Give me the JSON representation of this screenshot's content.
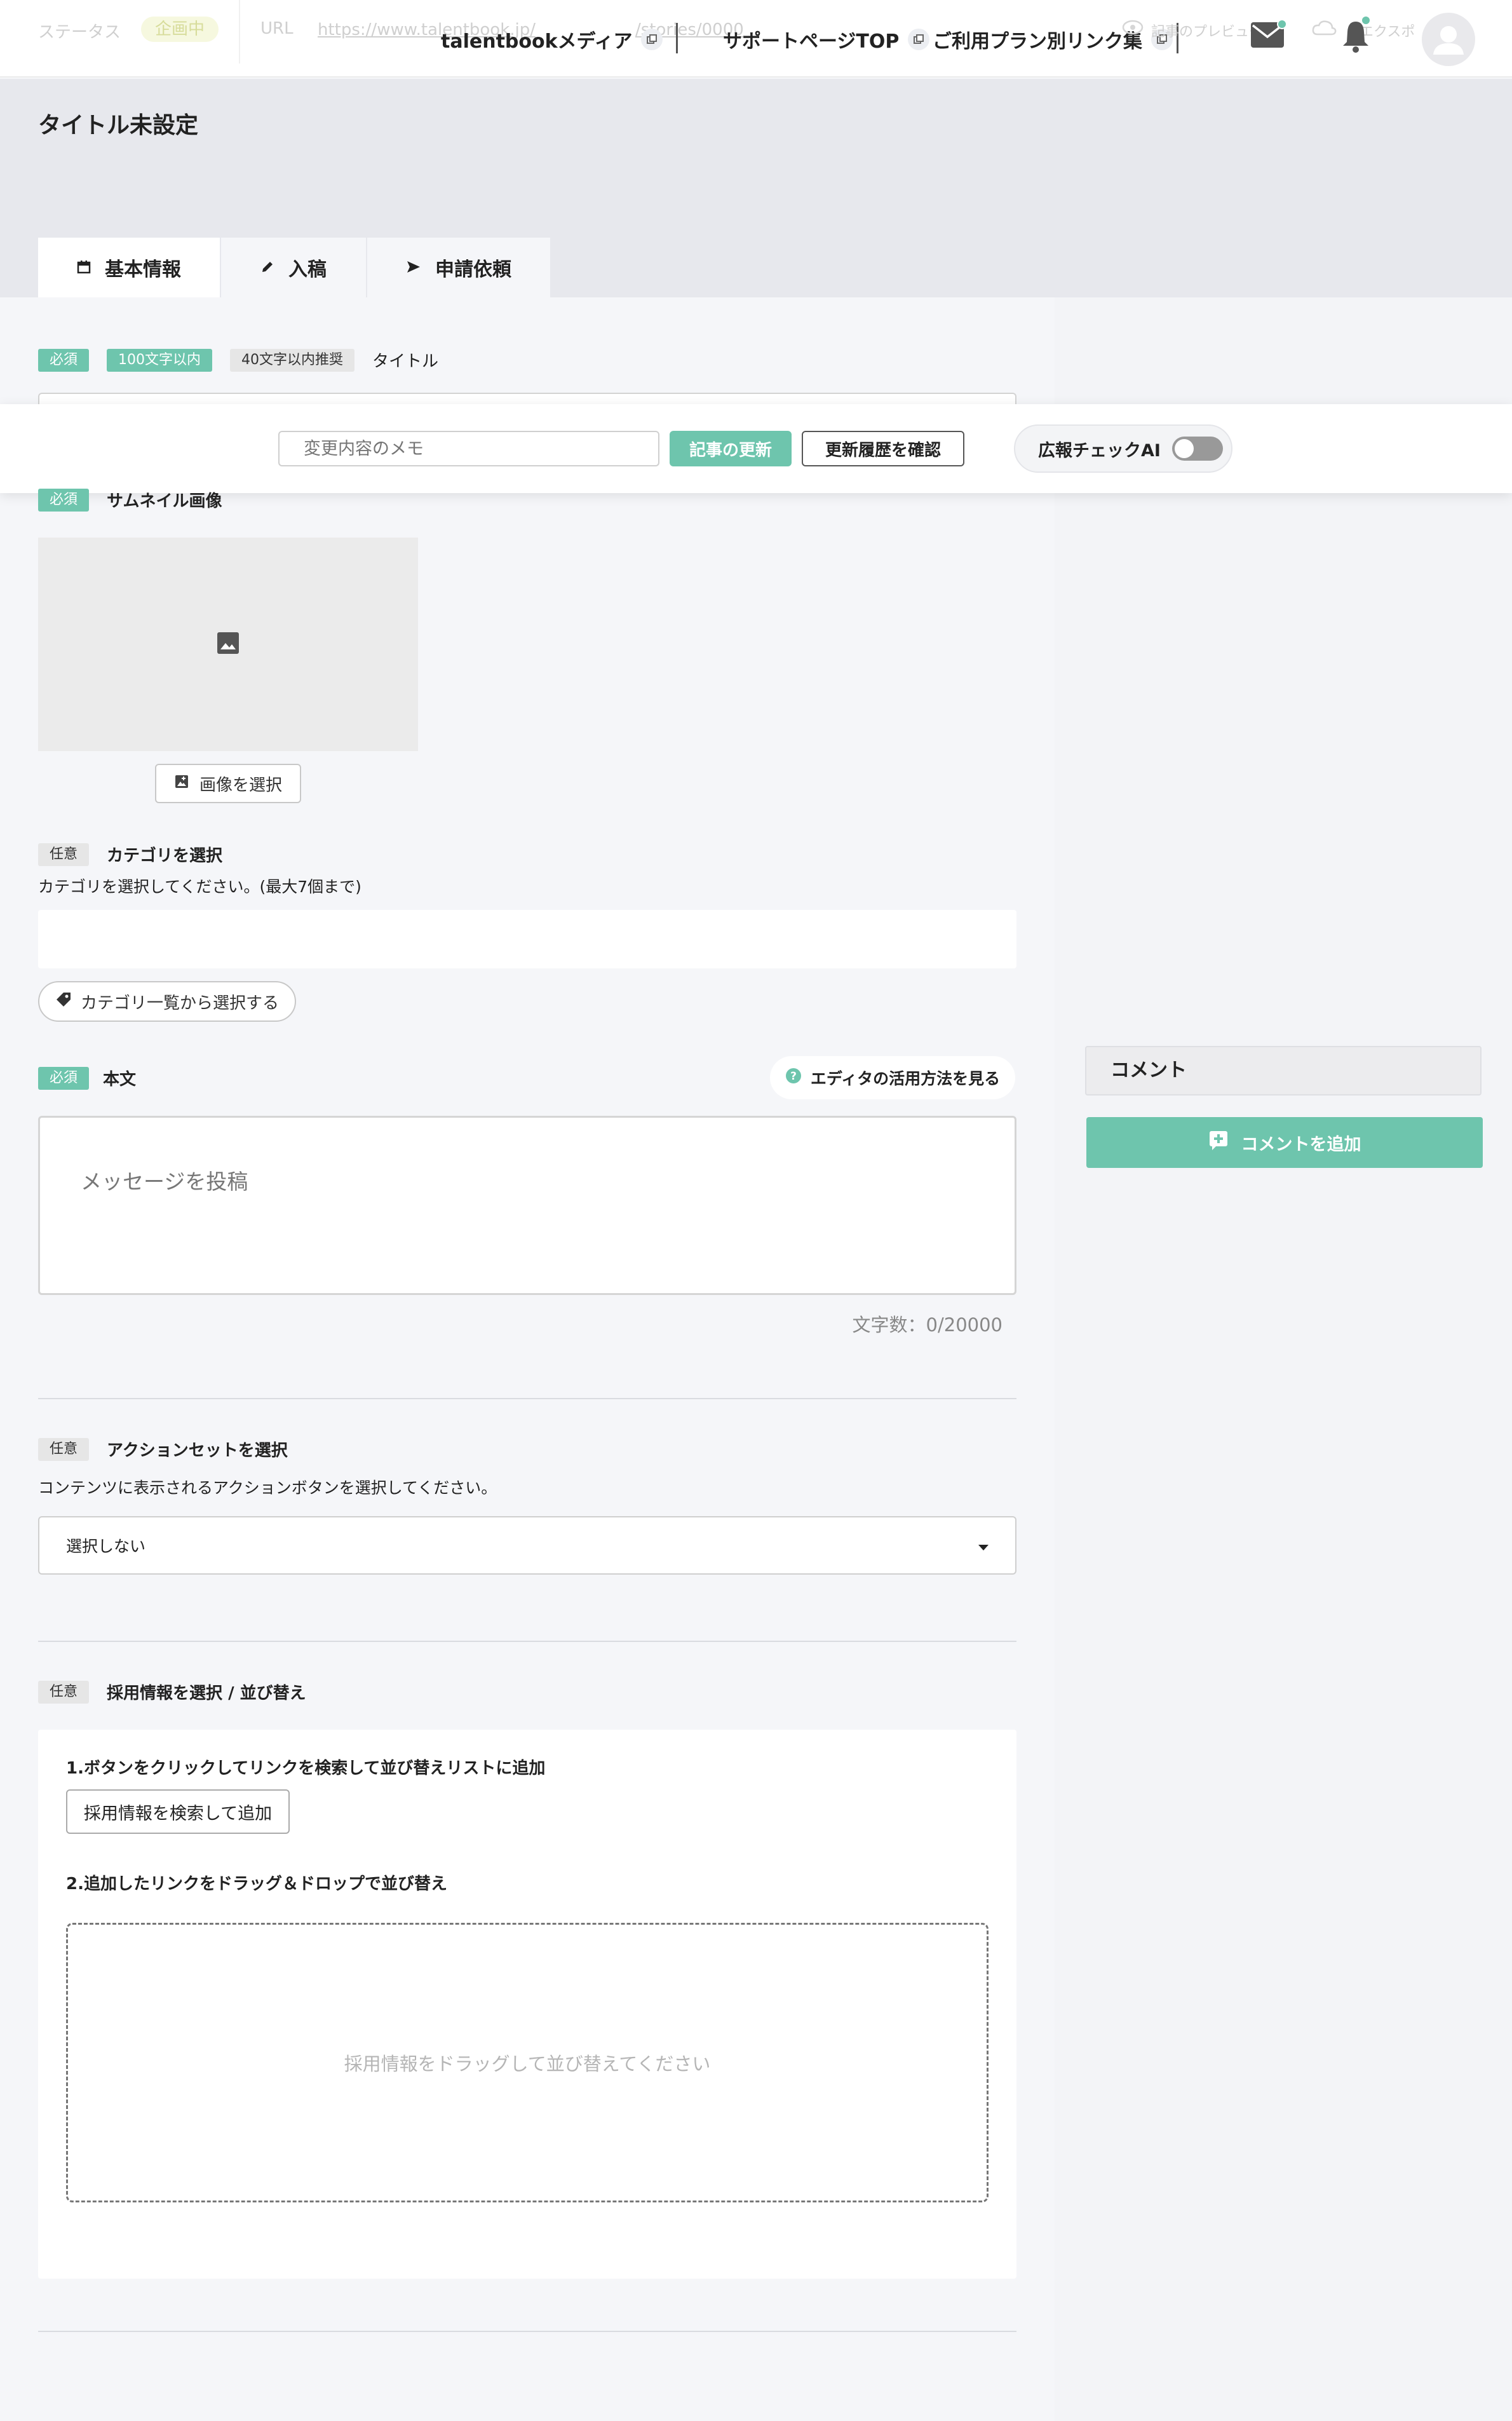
{
  "header": {
    "status_label": "ステータス",
    "status_value": "企画中",
    "url_label": "URL",
    "url_value": "https://www.talentbook.jp/",
    "url_tail": "/stories/0000",
    "links": [
      {
        "label": "talentbookメディア"
      },
      {
        "label": "サポートページTOP"
      },
      {
        "label": "ご利用プラン別リンク集"
      }
    ],
    "preview_label": "記事のプレビュー",
    "export_label": "エクスポ"
  },
  "page": {
    "title": "タイトル未設定",
    "tabs": [
      {
        "label": "基本情報",
        "icon": "calendar-icon"
      },
      {
        "label": "入稿",
        "icon": "pencil-icon"
      },
      {
        "label": "申請依頼",
        "icon": "send-icon"
      }
    ]
  },
  "toolbar": {
    "memo_placeholder": "変更内容のメモ",
    "update_label": "記事の更新",
    "history_label": "更新履歴を確認",
    "ai_check_label": "広報チェックAI",
    "ai_check_on": false
  },
  "form": {
    "title_field": {
      "required": "必須",
      "limit": "100文字以内",
      "recommend": "40文字以内推奨",
      "label": "タイトル"
    },
    "thumbnail": {
      "required": "必須",
      "label": "サムネイル画像",
      "select_label": "画像を選択"
    },
    "category": {
      "optional": "任意",
      "label": "カテゴリを選択",
      "help": "カテゴリを選択してください。(最大7個まで)",
      "button_label": "カテゴリ一覧から選択する"
    },
    "body": {
      "required": "必須",
      "label": "本文",
      "howto_label": "エディタの活用方法を見る",
      "placeholder": "メッセージを投稿",
      "count": "文字数：0/20000"
    },
    "action_set": {
      "optional": "任意",
      "label": "アクションセットを選択",
      "help": "コンテンツに表示されるアクションボタンを選択してください。",
      "selected": "選択しない"
    },
    "recruit": {
      "optional": "任意",
      "label": "採用情報を選択 / 並び替え",
      "step1": "1.ボタンをクリックしてリンクを検索して並び替えリストに追加",
      "search_label": "採用情報を検索して追加",
      "step2": "2.追加したリンクをドラッグ＆ドロップで並び替え",
      "drop_placeholder": "採用情報をドラッグして並び替えてください"
    }
  },
  "sidebar": {
    "comment_title": "コメント",
    "add_comment_label": "コメントを追加"
  },
  "colors": {
    "accent": "#6ec5ad",
    "background": "#f5f6f9",
    "title_band": "#e7e8ed"
  }
}
